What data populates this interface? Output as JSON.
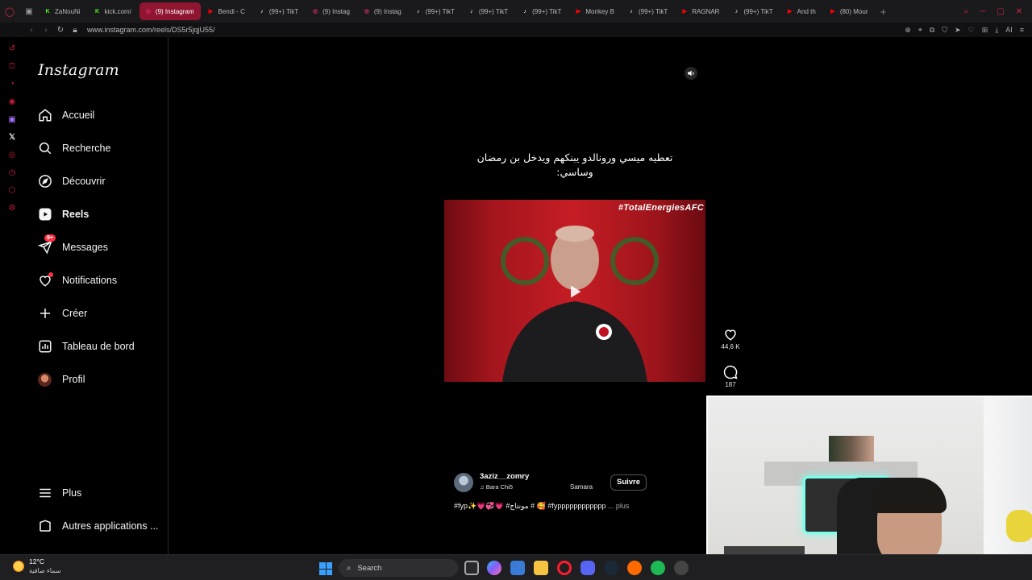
{
  "browser": {
    "tabs": [
      {
        "label": "ZaNouNi",
        "icon": "kick-icon",
        "color": "#53fc18",
        "glyph": "K"
      },
      {
        "label": "kick.com/",
        "icon": "kick-icon",
        "color": "#53fc18",
        "glyph": "K"
      },
      {
        "label": "(9) Instagram",
        "icon": "instagram-icon",
        "color": "#e1306c",
        "glyph": "◎",
        "active": true
      },
      {
        "label": "Bendi - C",
        "icon": "youtube-icon",
        "color": "#ff0000",
        "glyph": "▶"
      },
      {
        "label": "(99+) TikT",
        "icon": "tiktok-icon",
        "color": "#ffffff",
        "glyph": "♪"
      },
      {
        "label": "(9) Instag",
        "icon": "instagram-icon",
        "color": "#e1306c",
        "glyph": "◎"
      },
      {
        "label": "(9) Instag",
        "icon": "instagram-icon",
        "color": "#e1306c",
        "glyph": "◎"
      },
      {
        "label": "(99+) TikT",
        "icon": "tiktok-icon",
        "color": "#ffffff",
        "glyph": "♪"
      },
      {
        "label": "(99+) TikT",
        "icon": "tiktok-icon",
        "color": "#ffffff",
        "glyph": "♪"
      },
      {
        "label": "(99+) TikT",
        "icon": "tiktok-icon",
        "color": "#ffffff",
        "glyph": "♪"
      },
      {
        "label": "Monkey B",
        "icon": "youtube-icon",
        "color": "#ff0000",
        "glyph": "▶"
      },
      {
        "label": "(99+) TikT",
        "icon": "tiktok-icon",
        "color": "#ffffff",
        "glyph": "♪"
      },
      {
        "label": "RAGNAR",
        "icon": "youtube-icon",
        "color": "#ff0000",
        "glyph": "▶"
      },
      {
        "label": "(99+) TikT",
        "icon": "tiktok-icon",
        "color": "#ffffff",
        "glyph": "♪"
      },
      {
        "label": "And th",
        "icon": "youtube-icon",
        "color": "#ff0000",
        "glyph": "▶"
      },
      {
        "label": "(80) Mour",
        "icon": "youtube-icon",
        "color": "#ff0000",
        "glyph": "▶"
      }
    ],
    "url": "www.instagram.com/reels/DS5r5jqjU55/",
    "ai_label": "AI"
  },
  "instagram": {
    "logo": "Instagram",
    "nav": [
      {
        "key": "home",
        "label": "Accueil",
        "icon": "home-icon"
      },
      {
        "key": "search",
        "label": "Recherche",
        "icon": "search-icon"
      },
      {
        "key": "explore",
        "label": "Découvrir",
        "icon": "compass-icon"
      },
      {
        "key": "reels",
        "label": "Reels",
        "icon": "reels-icon",
        "active": true
      },
      {
        "key": "messages",
        "label": "Messages",
        "icon": "messenger-icon",
        "badge": "9+"
      },
      {
        "key": "notifications",
        "label": "Notifications",
        "icon": "heart-icon",
        "dot": true
      },
      {
        "key": "create",
        "label": "Créer",
        "icon": "plus-icon"
      },
      {
        "key": "dashboard",
        "label": "Tableau de bord",
        "icon": "chart-icon"
      },
      {
        "key": "profile",
        "label": "Profil",
        "icon": "avatar"
      }
    ],
    "more_label": "Plus",
    "apps_label": "Autres applications ..."
  },
  "reel": {
    "caption_ar": "تعطيه ميسي ورونالدو يبنكهم ويدخل بن رمضان وساسي:",
    "banner_text": "#TotalEnergiesAFC",
    "username": "3aziz__zomry",
    "music": "♫ Bara Chi5",
    "collab": "Samara",
    "follow_label": "Suivre",
    "hashtags": "#fyp✨💗💞💗 #مونتاج # 🥰 #fypppppppppppp",
    "more_label": "... plus",
    "likes": "44,6 K",
    "comments": "187"
  },
  "taskbar": {
    "temperature": "12°C",
    "condition": "سماء صافية",
    "search_label": "Search"
  },
  "colors": {
    "accent_red": "#c21d3b",
    "notification_red": "#ff3040",
    "active_tab": "#8f1530"
  }
}
